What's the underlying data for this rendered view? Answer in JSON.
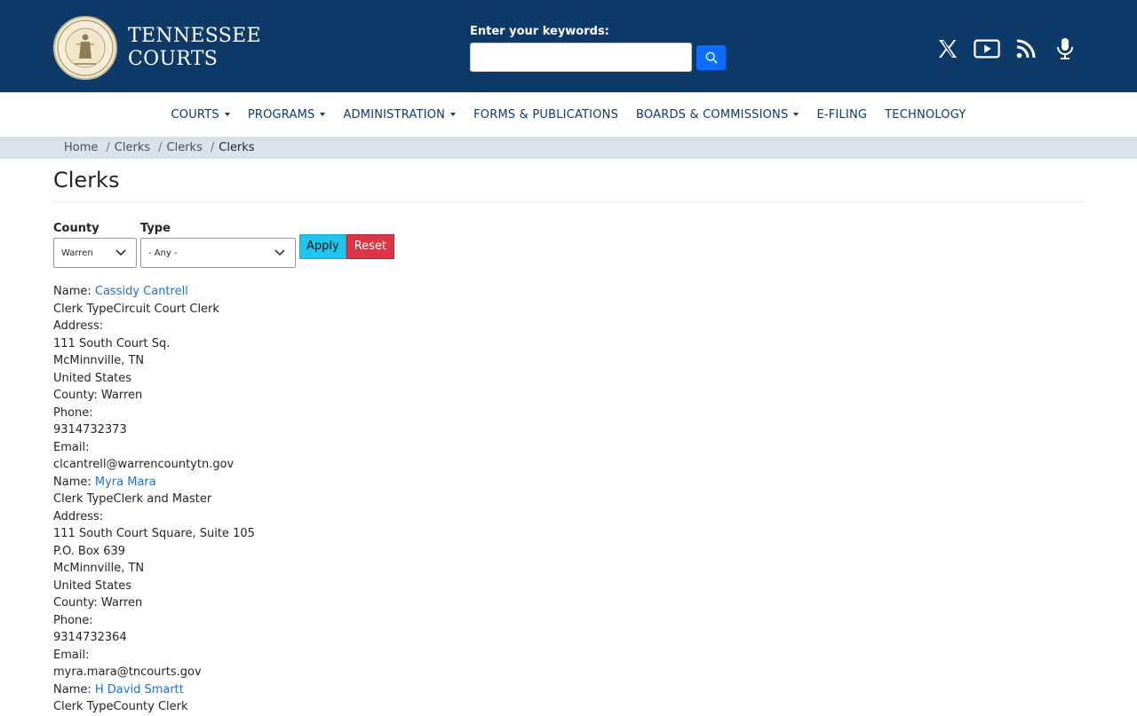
{
  "header": {
    "logo_line1": "TENNESSEE",
    "logo_line2": "COURTS",
    "search_label": "Enter your keywords:",
    "search_value": "",
    "social_icons": [
      "x-icon",
      "youtube-icon",
      "rss-icon",
      "podcast-microphone-icon"
    ]
  },
  "nav": [
    {
      "label": "COURTS",
      "dropdown": true
    },
    {
      "label": "PROGRAMS",
      "dropdown": true
    },
    {
      "label": "ADMINISTRATION",
      "dropdown": true
    },
    {
      "label": "FORMS & PUBLICATIONS",
      "dropdown": false
    },
    {
      "label": "BOARDS & COMMISSIONS",
      "dropdown": true
    },
    {
      "label": "E-FILING",
      "dropdown": false
    },
    {
      "label": "TECHNOLOGY",
      "dropdown": false
    }
  ],
  "breadcrumb": [
    "Home",
    "Clerks",
    "Clerks",
    "Clerks"
  ],
  "page_title": "Clerks",
  "filters": {
    "county_label": "County",
    "county_value": "Warren",
    "type_label": "Type",
    "type_value": "- Any -",
    "apply_label": "Apply",
    "reset_label": "Reset"
  },
  "clerks": [
    {
      "name": "Cassidy Cantrell",
      "type_line": "Clerk TypeCircuit Court Clerk",
      "address_lines": [
        "111 South Court Sq.",
        "McMinnville, TN",
        "United States"
      ],
      "county_line": "County: Warren",
      "phone": "9314732373",
      "email": "clcantrell@warrencountytn.gov"
    },
    {
      "name": "Myra Mara",
      "type_line": "Clerk TypeClerk and Master",
      "address_lines": [
        "111 South Court Square, Suite 105",
        "P.O. Box 639",
        "McMinnville, TN",
        "United States"
      ],
      "county_line": "County: Warren",
      "phone": "9314732364",
      "email": "myra.mara@tncourts.gov"
    },
    {
      "name": "H David Smartt",
      "type_line": "Clerk TypeCounty Clerk"
    }
  ],
  "labels": {
    "name": "Name: ",
    "address": "Address:",
    "phone": "Phone:",
    "email": "Email:"
  },
  "colors": {
    "header_bg": "#0e3a6a",
    "breadcrumb_bg": "#dae2ea",
    "apply_bg": "#20c4f0",
    "reset_bg": "#dc3545",
    "link": "#1f6fd1"
  }
}
